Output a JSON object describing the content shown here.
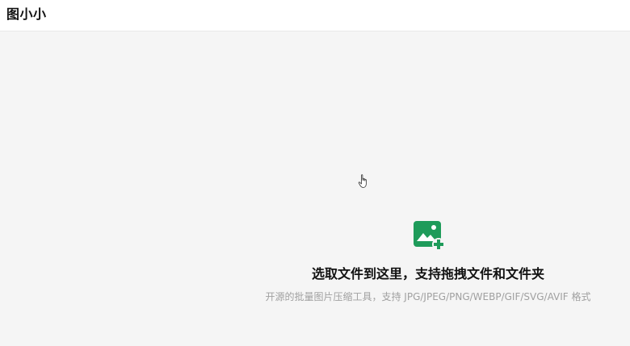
{
  "header": {
    "title": "图小小"
  },
  "dropzone": {
    "icon": "image-add-icon",
    "title": "选取文件到这里，支持拖拽文件和文件夹",
    "subtitle": "开源的批量图片压缩工具，支持 JPG/JPEG/PNG/WEBP/GIF/SVG/AVIF 格式"
  },
  "colors": {
    "accent": "#1e9b5a",
    "header_bg": "#ffffff",
    "body_bg": "#f5f5f5",
    "subtitle": "#a0a0a0"
  }
}
